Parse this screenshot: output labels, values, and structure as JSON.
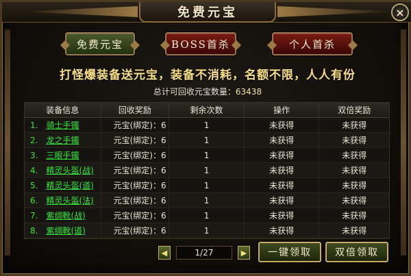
{
  "window": {
    "title": "免费元宝",
    "close_label": "×"
  },
  "tabs": [
    {
      "label": "免费元宝",
      "active": true
    },
    {
      "label": "BOSS首杀",
      "active": false
    },
    {
      "label": "个人首杀",
      "active": false
    }
  ],
  "slogan": "打怪爆装备送元宝，装备不消耗，名额不限，人人有份",
  "total": {
    "label": "总计可回收元宝数量：",
    "value": "63438"
  },
  "table": {
    "headers": [
      "装备信息",
      "回收奖励",
      "剩余次数",
      "操作",
      "双倍奖励"
    ],
    "rows": [
      {
        "index": "1.",
        "item": "骑士手镯",
        "reward": "元宝(绑定)：6",
        "remaining": "1",
        "action": "未获得",
        "double": "未获得"
      },
      {
        "index": "2.",
        "item": "龙之手镯",
        "reward": "元宝(绑定)：6",
        "remaining": "1",
        "action": "未获得",
        "double": "未获得"
      },
      {
        "index": "3.",
        "item": "三眼手镯",
        "reward": "元宝(绑定)：6",
        "remaining": "1",
        "action": "未获得",
        "double": "未获得"
      },
      {
        "index": "4.",
        "item": "精灵头盔(战)",
        "reward": "元宝(绑定)：6",
        "remaining": "1",
        "action": "未获得",
        "double": "未获得"
      },
      {
        "index": "5.",
        "item": "精灵头盔(道)",
        "reward": "元宝(绑定)：6",
        "remaining": "1",
        "action": "未获得",
        "double": "未获得"
      },
      {
        "index": "6.",
        "item": "精灵头盔(法)",
        "reward": "元宝(绑定)：6",
        "remaining": "1",
        "action": "未获得",
        "double": "未获得"
      },
      {
        "index": "7.",
        "item": "紫绸靴(战)",
        "reward": "元宝(绑定)：6",
        "remaining": "1",
        "action": "未获得",
        "double": "未获得"
      },
      {
        "index": "8.",
        "item": "紫绸靴(道)",
        "reward": "元宝(绑定)：6",
        "remaining": "1",
        "action": "未获得",
        "double": "未获得"
      }
    ]
  },
  "pager": {
    "prev_icon": "◀",
    "next_icon": "▶",
    "text": "1/27"
  },
  "buttons": {
    "claim_all": "一键领取",
    "double_claim": "双倍领取"
  },
  "colors": {
    "item_link": "#36e83a",
    "slogan": "#f7df8a",
    "frame_gold": "#9c7a45"
  }
}
